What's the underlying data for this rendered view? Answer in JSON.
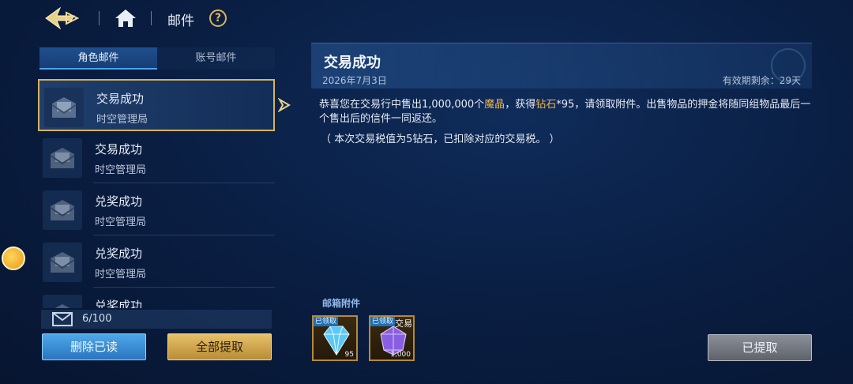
{
  "header": {
    "title": "邮件",
    "help_label": "?"
  },
  "tabs": [
    {
      "label": "角色邮件",
      "active": true
    },
    {
      "label": "账号邮件",
      "active": false
    }
  ],
  "mails": [
    {
      "subject": "交易成功",
      "sender": "时空管理局",
      "selected": true
    },
    {
      "subject": "交易成功",
      "sender": "时空管理局",
      "selected": false
    },
    {
      "subject": "兑奖成功",
      "sender": "时空管理局",
      "selected": false
    },
    {
      "subject": "兑奖成功",
      "sender": "时空管理局",
      "selected": false
    },
    {
      "subject": "兑奖成功",
      "sender": "",
      "selected": false
    }
  ],
  "mail_count": "6/100",
  "buttons": {
    "delete_read": "删除已读",
    "claim_all": "全部提取",
    "claimed": "已提取"
  },
  "detail": {
    "title": "交易成功",
    "date": "2026年7月3日",
    "expire": "有效期剩余：29天",
    "body_part1": "恭喜您在交易行中售出1,000,000个",
    "body_highlight1": "魔晶",
    "body_part2": "，获得",
    "body_highlight2": "钻石",
    "body_part3": "*95，请领取附件。出售物品的押金将随同组物品最后一个售出后的信件一同返还。",
    "note": "（ 本次交易税值为5钻石，已扣除对应的交易税。 ）"
  },
  "attachments": {
    "title": "邮箱附件",
    "items": [
      {
        "name": "diamond",
        "tag": "已领取",
        "quantity": "95",
        "extra": ""
      },
      {
        "name": "magic-crystal",
        "tag": "已领取",
        "quantity": "1,000",
        "extra": "交易"
      }
    ]
  },
  "colors": {
    "highlight": "#f0b44a",
    "gold_border": "#d6b25c",
    "blue_button": "#2a74c0"
  }
}
